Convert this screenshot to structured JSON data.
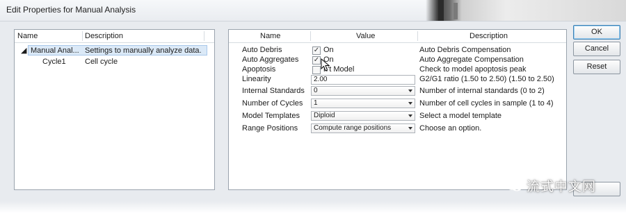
{
  "window": {
    "title": "Edit Properties for Manual Analysis"
  },
  "tree": {
    "columns": [
      "Name",
      "Description"
    ],
    "rows": [
      {
        "name": "Manual Anal...",
        "description": "Settings to manually analyze data.",
        "expanded": true,
        "selected": true
      },
      {
        "name": "Cycle1",
        "description": "Cell cycle"
      }
    ]
  },
  "properties": {
    "columns": [
      "Name",
      "Value",
      "Description"
    ],
    "rows": [
      {
        "name": "Auto Debris",
        "type": "checkbox",
        "checked": true,
        "value": "On",
        "description": "Auto Debris Compensation"
      },
      {
        "name": "Auto Aggregates",
        "type": "checkbox",
        "checked": true,
        "value": "On",
        "description": "Auto Aggregate Compensation"
      },
      {
        "name": "Apoptosis",
        "type": "checkbox",
        "checked": false,
        "value": "n't Model",
        "description": "Check to model apoptosis peak"
      },
      {
        "name": "Linearity",
        "type": "text",
        "value": "2.00",
        "description": "G2/G1 ratio (1.50 to 2.50) (1.50 to 2.50)"
      },
      {
        "name": "Internal Standards",
        "type": "select",
        "value": "0",
        "description": "Number of internal standards (0 to 2)"
      },
      {
        "name": "Number of Cycles",
        "type": "select",
        "value": "1",
        "description": "Number of cell cycles in sample (1 to 4)"
      },
      {
        "name": "Model Templates",
        "type": "select",
        "value": "Diploid",
        "description": "Select a model template"
      },
      {
        "name": "Range Positions",
        "type": "select",
        "value": "Compute range positions",
        "description": "Choose an option."
      }
    ]
  },
  "buttons": {
    "ok": "OK",
    "cancel": "Cancel",
    "reset": "Reset"
  },
  "watermark": "流式中文网",
  "colors": {
    "selection": "#dbe9f7",
    "default_button_border": "#3c7fb1"
  }
}
